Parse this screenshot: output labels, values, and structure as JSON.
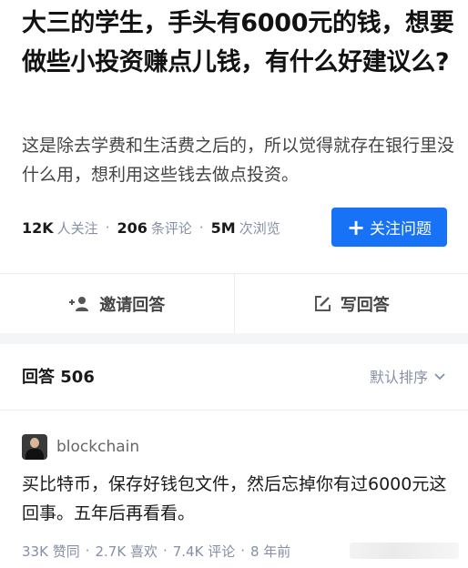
{
  "question": {
    "title": "大三的学生，手头有6000元的钱，想要做些小投资赚点儿钱，有什么好建议么?",
    "description": "这是除去学费和生活费之后的，所以觉得就存在银行里没什么用，想利用这些钱去做点投资。",
    "followers_num": "12K",
    "followers_label": "人关注",
    "comments_num": "206",
    "comments_label": "条评论",
    "views_num": "5M",
    "views_label": "次浏览",
    "follow_button": "关注问题"
  },
  "actions": {
    "invite_label": "邀请回答",
    "write_label": "写回答"
  },
  "answers": {
    "count_label": "回答 506",
    "sort_label": "默认排序"
  },
  "answer": {
    "author": "blockchain",
    "text": "买比特币，保存好钱包文件，然后忘掉你有过6000元这回事。五年后再看看。",
    "upvotes": "33K 赞同",
    "likes": "2.7K 喜欢",
    "comments": "7.4K 评论",
    "time": "8 年前"
  },
  "colors": {
    "accent": "#1772f6",
    "muted": "#8590a6",
    "text": "#121212"
  }
}
